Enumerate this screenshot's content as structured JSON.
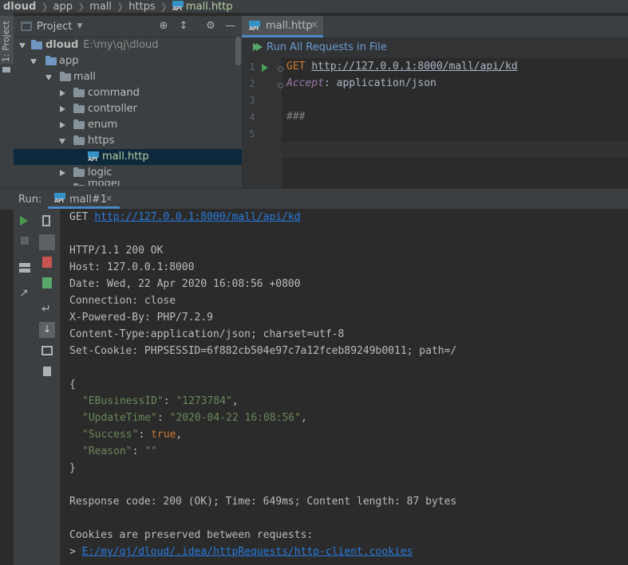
{
  "breadcrumb": [
    "dloud",
    "app",
    "mall",
    "https",
    "mall.http"
  ],
  "side_tab": "1: Project",
  "project": {
    "title": "Project",
    "root_path": "E:\\my\\qj\\dloud",
    "items": [
      {
        "label": "dloud",
        "depth": 0,
        "state": "down",
        "type": "folder-blue",
        "bold": true
      },
      {
        "label": "app",
        "depth": 1,
        "state": "down",
        "type": "folder-blue"
      },
      {
        "label": "mall",
        "depth": 2,
        "state": "down",
        "type": "folder"
      },
      {
        "label": "command",
        "depth": 3,
        "state": "right",
        "type": "folder"
      },
      {
        "label": "controller",
        "depth": 3,
        "state": "right",
        "type": "folder"
      },
      {
        "label": "enum",
        "depth": 3,
        "state": "right",
        "type": "folder"
      },
      {
        "label": "https",
        "depth": 3,
        "state": "down",
        "type": "folder"
      },
      {
        "label": "mall.http",
        "depth": 4,
        "state": "none",
        "type": "api",
        "selected": true
      },
      {
        "label": "logic",
        "depth": 3,
        "state": "right",
        "type": "folder"
      },
      {
        "label": "model",
        "depth": 3,
        "state": "right",
        "type": "folder"
      }
    ]
  },
  "editor": {
    "tab_label": "mall.http",
    "run_all_label": "Run All Requests in File",
    "line_numbers": [
      "1",
      "2",
      "3",
      "4",
      "5"
    ],
    "method": "GET",
    "url": "http://127.0.0.1:8000/mall/api/kd",
    "header_name": "Accept",
    "header_value": ": application/json",
    "separator": "###"
  },
  "run": {
    "title": "Run:",
    "tab_label": "mall#1",
    "console": {
      "method": "GET ",
      "url": "http://127.0.0.1:8000/mall/api/kd",
      "status": "HTTP/1.1 200 OK",
      "headers": [
        "Host: 127.0.0.1:8000",
        "Date: Wed, 22 Apr 2020 16:08:56 +0800",
        "Connection: close",
        "X-Powered-By: PHP/7.2.9",
        "Content-Type:application/json; charset=utf-8",
        "Set-Cookie: PHPSESSID=6f882cb504e97c7a12fceb89249b0011; path=/"
      ],
      "json_open": "{",
      "json_lines": [
        {
          "key": "\"EBusinessID\"",
          "sep": ": ",
          "value": "\"1273784\"",
          "kind": "str",
          "end": ","
        },
        {
          "key": "\"UpdateTime\"",
          "sep": ": ",
          "value": "\"2020-04-22 16:08:56\"",
          "kind": "str",
          "end": ","
        },
        {
          "key": "\"Success\"",
          "sep": ": ",
          "value": "true",
          "kind": "kw",
          "end": ","
        },
        {
          "key": "\"Reason\"",
          "sep": ": ",
          "value": "\"\"",
          "kind": "str",
          "end": ""
        }
      ],
      "json_close": "}",
      "response_line": "Response code: 200 (OK); Time: 649ms; Content length: 87 bytes",
      "cookies_line": "Cookies are preserved between requests:",
      "cookies_prefix": "> ",
      "cookies_path": "E:/my/qj/dloud/.idea/httpRequests/http-client.cookies"
    }
  },
  "colors": {
    "bg": "#2b2b2b",
    "panel": "#3c3f41",
    "selection": "#0d293e",
    "accent": "#4a88c7",
    "link": "#287bde",
    "run_green": "#499c54"
  }
}
